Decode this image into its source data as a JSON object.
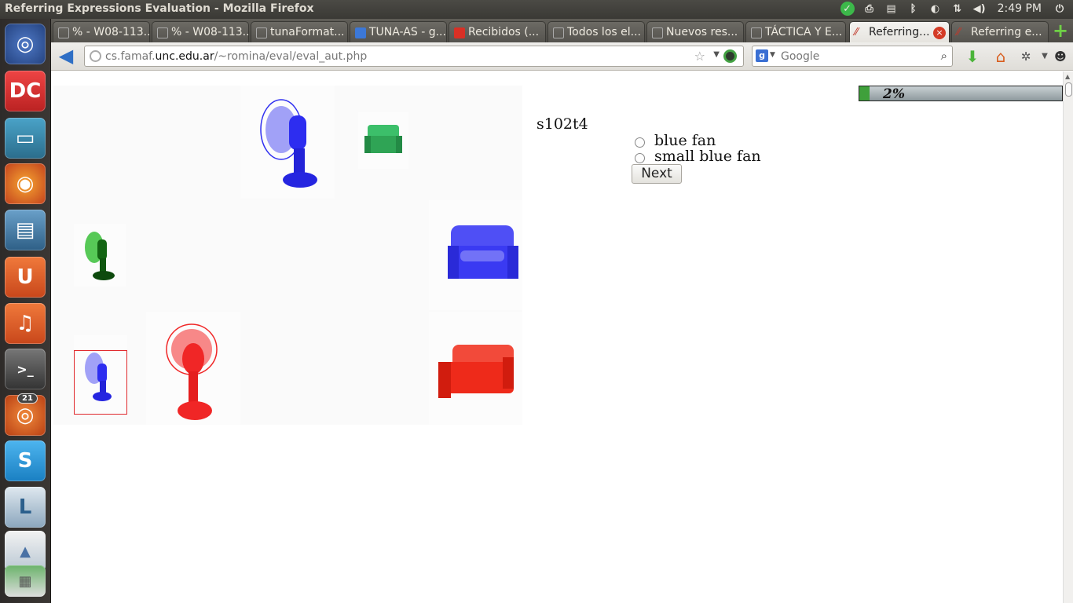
{
  "window": {
    "title": "Referring Expressions Evaluation - Mozilla Firefox"
  },
  "tray": {
    "time": "2:49 PM"
  },
  "launcher": {
    "badge": "21"
  },
  "tabs": [
    {
      "label": "% - W08-113..."
    },
    {
      "label": "% - W08-113..."
    },
    {
      "label": "tunaFormat..."
    },
    {
      "label": "TUNA-AS - g..."
    },
    {
      "label": "Recibidos (..."
    },
    {
      "label": "Todos los el..."
    },
    {
      "label": "Nuevos res..."
    },
    {
      "label": "TÁCTICA Y E..."
    },
    {
      "label": "Referring..."
    },
    {
      "label": "Referring e..."
    }
  ],
  "navbar": {
    "url_prefix": "cs.famaf.",
    "url_host": "unc.edu.ar",
    "url_path": "/~romina/eval/eval_aut.php",
    "search_placeholder": "Google",
    "search_engine_letter": "g"
  },
  "page": {
    "trial_id": "s102t4",
    "options": [
      {
        "label": "blue fan",
        "selected": false
      },
      {
        "label": "small blue fan",
        "selected": false
      }
    ],
    "next_label": "Next",
    "progress_label": "2%",
    "progress_fraction": 0.02
  },
  "scene": {
    "objects": [
      {
        "name": "large-blue-fan",
        "color": "#2d2df0"
      },
      {
        "name": "small-green-sofa",
        "color": "#2fa455"
      },
      {
        "name": "small-green-fan",
        "color": "#1e8a1e"
      },
      {
        "name": "large-blue-sofa",
        "color": "#3a3af2"
      },
      {
        "name": "small-blue-fan-target",
        "color": "#2d2df0"
      },
      {
        "name": "large-red-fan",
        "color": "#f02626"
      },
      {
        "name": "large-red-sofa",
        "color": "#ee2a1a"
      }
    ],
    "target_outline_color": "#e0282c"
  }
}
